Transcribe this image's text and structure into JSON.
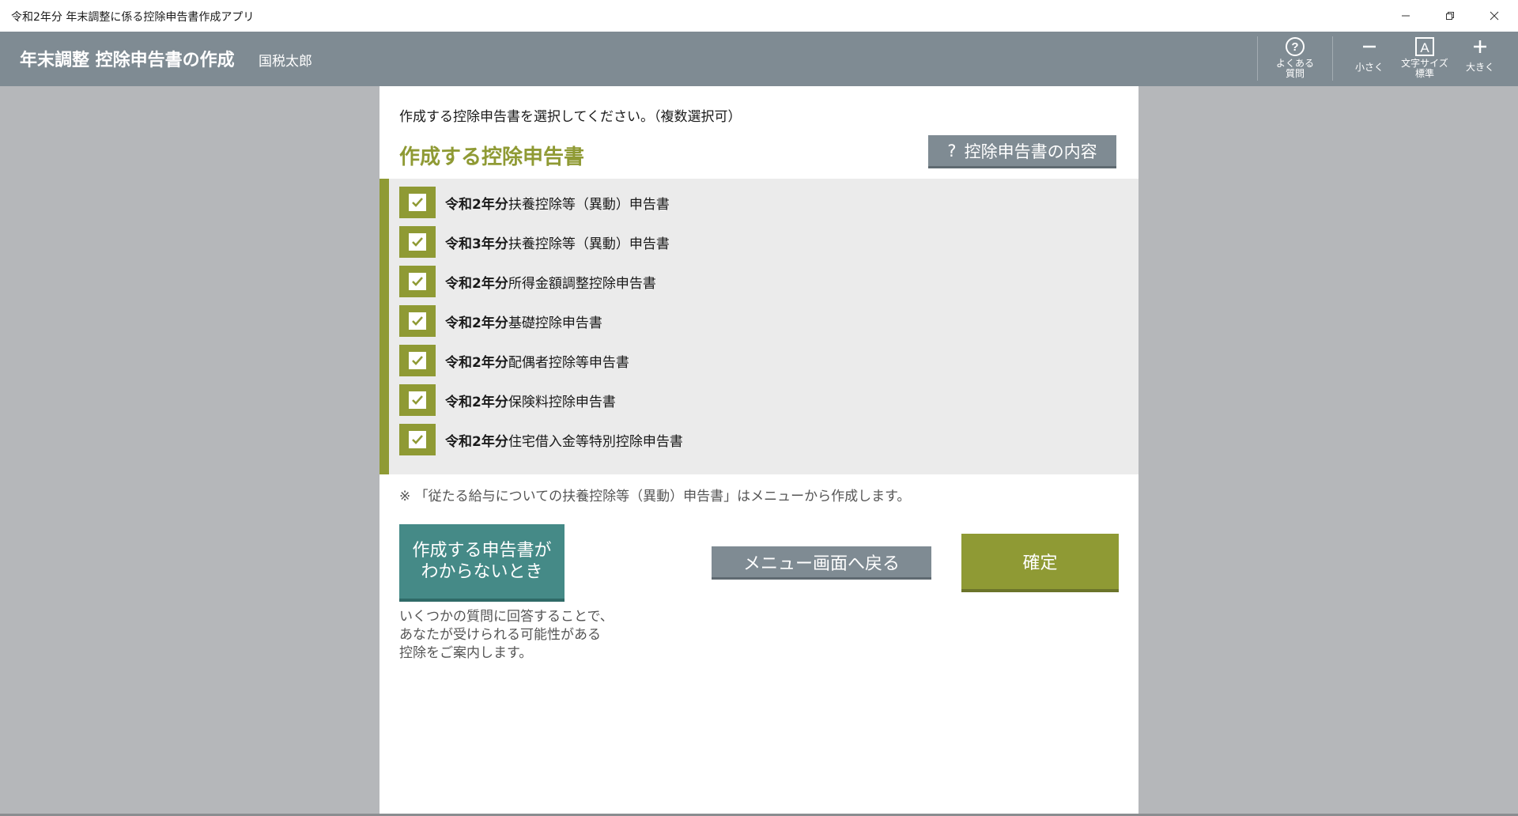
{
  "window": {
    "title": "令和2年分 年末調整に係る控除申告書作成アプリ",
    "controls": [
      "minimize-icon",
      "restore-icon",
      "close-icon"
    ]
  },
  "header": {
    "title": "年末調整 控除申告書の作成",
    "user": "国税太郎",
    "tools": {
      "faq": "よくある\n質問",
      "smaller": "小さく",
      "font_size": "文字サイズ\n標準",
      "larger": "大きく"
    }
  },
  "main": {
    "instruction": "作成する控除申告書を選択してください。（複数選択可）",
    "section_title": "作成する控除申告書",
    "help_button": {
      "icon": "?",
      "label": "控除申告書の内容"
    },
    "items": [
      {
        "year": "令和2年分",
        "name": "扶養控除等（異動）申告書",
        "checked": true
      },
      {
        "year": "令和3年分",
        "name": "扶養控除等（異動）申告書",
        "checked": true
      },
      {
        "year": "令和2年分",
        "name": "所得金額調整控除申告書",
        "checked": true
      },
      {
        "year": "令和2年分",
        "name": "基礎控除申告書",
        "checked": true
      },
      {
        "year": "令和2年分",
        "name": "配偶者控除等申告書",
        "checked": true
      },
      {
        "year": "令和2年分",
        "name": "保険料控除申告書",
        "checked": true
      },
      {
        "year": "令和2年分",
        "name": "住宅借入金等特別控除申告書",
        "checked": true
      }
    ],
    "note": "※ 「従たる給与についての扶養控除等（異動）申告書」はメニューから作成します。",
    "unknown_button": "作成する申告書がわからないとき",
    "unknown_desc": "いくつかの質問に回答することで、\nあなたが受けられる可能性がある\n控除をご案内します。",
    "menu_button": "メニュー画面へ戻る",
    "confirm_button": "確定"
  },
  "colors": {
    "accent_olive": "#8f9a34",
    "teal": "#458a87",
    "header_gray": "#7f8b93",
    "background": "#b5b7ba"
  }
}
